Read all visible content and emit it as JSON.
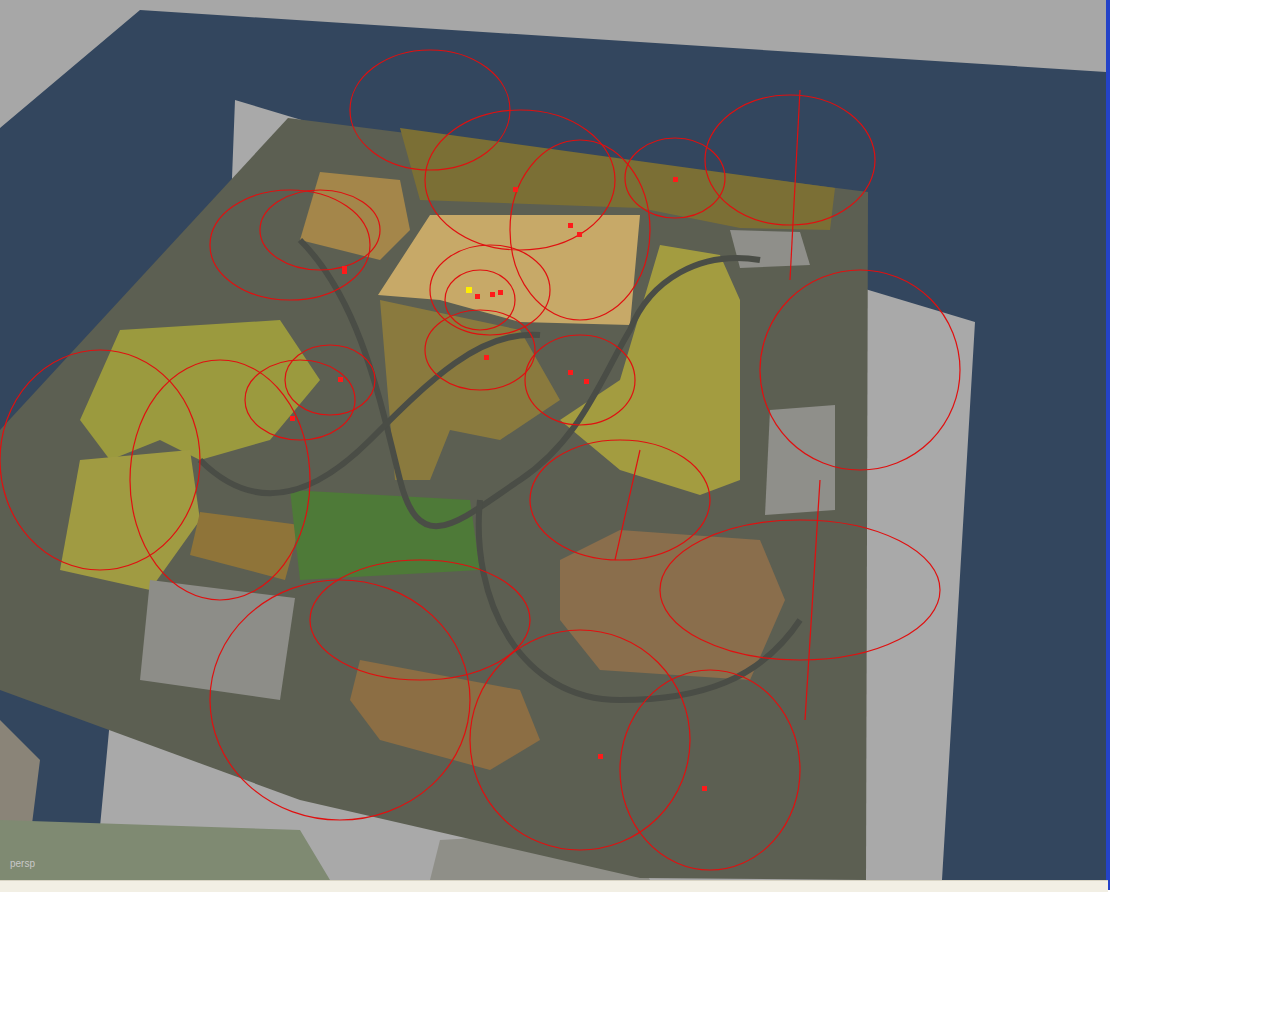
{
  "viewport": {
    "camera": "persp"
  }
}
